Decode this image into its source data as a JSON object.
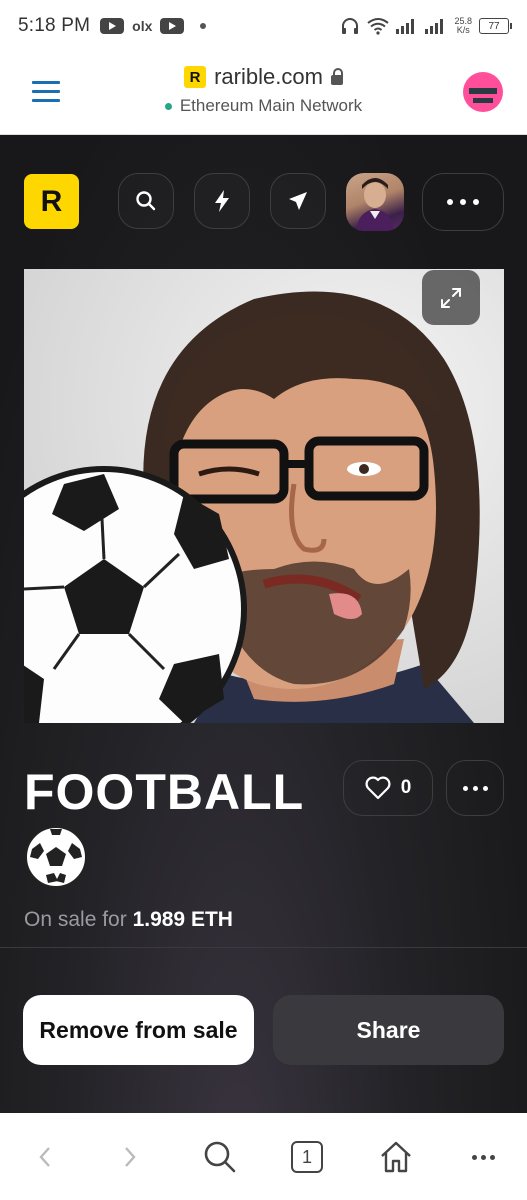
{
  "status_bar": {
    "time": "5:18 PM",
    "notification_icons": [
      "youtube-icon",
      "olx-icon",
      "youtube-icon"
    ],
    "olx_label": "olx",
    "net_speed_value": "25.8",
    "net_speed_unit": "K/s",
    "battery": "77"
  },
  "browser": {
    "domain": "rarible.com",
    "network": "Ethereum Main Network",
    "logo_letter": "R",
    "accent": "#1a6fb3"
  },
  "header": {
    "logo_letter": "R",
    "logo_color": "#fed700",
    "buttons": [
      "search-icon",
      "lightning-icon",
      "send-icon",
      "profile-avatar",
      "more-icon"
    ]
  },
  "item": {
    "title": "FOOTBALL",
    "emoji": "⚽",
    "likes": "0",
    "sale_prefix": "On sale for",
    "price": "1.989 ETH"
  },
  "actions": {
    "remove": "Remove from sale",
    "share": "Share"
  },
  "nav": {
    "tab_count": "1",
    "items": [
      "back-icon",
      "forward-icon",
      "search-icon",
      "tabs-icon",
      "home-icon",
      "more-icon"
    ]
  }
}
